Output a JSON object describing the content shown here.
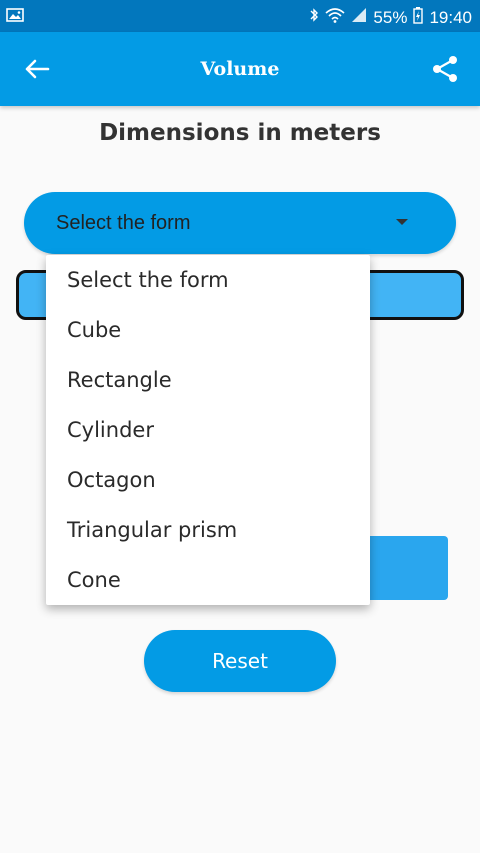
{
  "status_bar": {
    "battery": "55%",
    "time": "19:40"
  },
  "app_bar": {
    "title": "Volume",
    "back_icon": "arrow-left-icon",
    "share_icon": "share-icon"
  },
  "heading": "Dimensions in meters",
  "form_select": {
    "selected": "Select the form",
    "options": [
      "Select the form",
      "Cube",
      "Rectangle",
      "Cylinder",
      "Octagon",
      "Triangular prism",
      "Cone"
    ]
  },
  "reset_label": "Reset",
  "colors": {
    "status_bar": "#0277bd",
    "app_bar": "#039be5",
    "accent": "#039be5",
    "input_bar": "#42b4f5"
  }
}
